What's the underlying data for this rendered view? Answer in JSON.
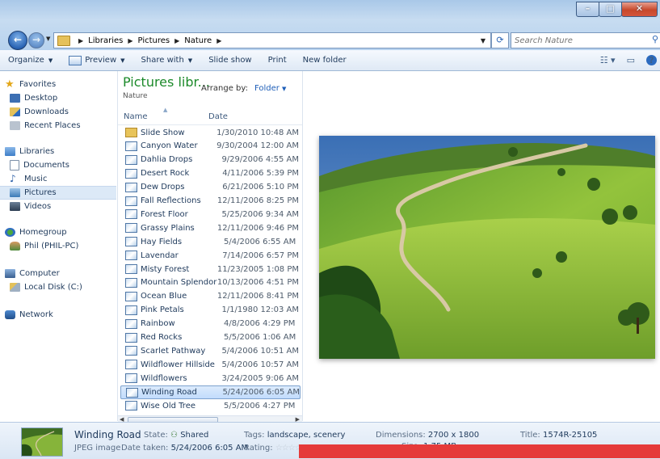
{
  "window": {
    "caption_buttons": [
      "minimize",
      "maximize",
      "close"
    ]
  },
  "address": {
    "crumbs": [
      "Libraries",
      "Pictures",
      "Nature"
    ],
    "search_placeholder": "Search Nature"
  },
  "toolbar": {
    "organize": "Organize",
    "preview": "Preview",
    "share_with": "Share with",
    "slide_show": "Slide show",
    "print": "Print",
    "new_folder": "New folder"
  },
  "nav": {
    "favorites": "Favorites",
    "desktop": "Desktop",
    "downloads": "Downloads",
    "recent": "Recent Places",
    "libraries": "Libraries",
    "documents": "Documents",
    "music": "Music",
    "pictures": "Pictures",
    "videos": "Videos",
    "homegroup": "Homegroup",
    "phil": "Phil (PHIL-PC)",
    "computer": "Computer",
    "localdisk": "Local Disk (C:)",
    "network": "Network"
  },
  "library": {
    "title": "Pictures libr...",
    "subtitle": "Nature",
    "arrange_label": "Arrange by:",
    "arrange_value": "Folder"
  },
  "columns": {
    "name": "Name",
    "date": "Date"
  },
  "files": [
    {
      "name": "Slide Show",
      "date": "1/30/2010 10:48 AM",
      "folder": true
    },
    {
      "name": "Canyon Water",
      "date": "9/30/2004 12:00 AM"
    },
    {
      "name": "Dahlia Drops",
      "date": "9/29/2006 4:55 AM"
    },
    {
      "name": "Desert Rock",
      "date": "4/11/2006 5:39 PM"
    },
    {
      "name": "Dew Drops",
      "date": "6/21/2006 5:10 PM"
    },
    {
      "name": "Fall Reflections",
      "date": "12/11/2006 8:25 PM"
    },
    {
      "name": "Forest Floor",
      "date": "5/25/2006 9:34 AM"
    },
    {
      "name": "Grassy Plains",
      "date": "12/11/2006 9:46 PM"
    },
    {
      "name": "Hay Fields",
      "date": "5/4/2006 6:55 AM"
    },
    {
      "name": "Lavendar",
      "date": "7/14/2006 6:57 PM"
    },
    {
      "name": "Misty Forest",
      "date": "11/23/2005 1:08 PM"
    },
    {
      "name": "Mountain Splendor",
      "date": "10/13/2006 4:51 PM"
    },
    {
      "name": "Ocean Blue",
      "date": "12/11/2006 8:41 PM"
    },
    {
      "name": "Pink Petals",
      "date": "1/1/1980 12:03 AM"
    },
    {
      "name": "Rainbow",
      "date": "4/8/2006 4:29 PM"
    },
    {
      "name": "Red Rocks",
      "date": "5/5/2006 1:06 AM"
    },
    {
      "name": "Scarlet Pathway",
      "date": "5/4/2006 10:51 AM"
    },
    {
      "name": "Wildflower Hillside",
      "date": "5/4/2006 10:57 AM"
    },
    {
      "name": "Wildflowers",
      "date": "3/24/2005 9:06 AM"
    },
    {
      "name": "Winding Road",
      "date": "5/24/2006 6:05 AM",
      "selected": true
    },
    {
      "name": "Wise Old Tree",
      "date": "5/5/2006 4:27 PM"
    }
  ],
  "details": {
    "filename": "Winding Road",
    "filetype": "JPEG image",
    "state_label": "State:",
    "state_value": "Shared",
    "date_taken_label": "Date taken:",
    "date_taken_value": "5/24/2006 6:05 AM",
    "tags_label": "Tags:",
    "tags_value": "landscape, scenery",
    "rating_label": "Rating:",
    "dimensions_label": "Dimensions:",
    "dimensions_value": "2700 x 1800",
    "size_label": "Size:",
    "size_value": "1.75 MB",
    "title_label": "Title:",
    "title_value": "1574R-25105"
  },
  "colors": {
    "accent": "#1e395b",
    "library_title": "#1c8a2a",
    "overlay_red": "#e53a3a"
  }
}
